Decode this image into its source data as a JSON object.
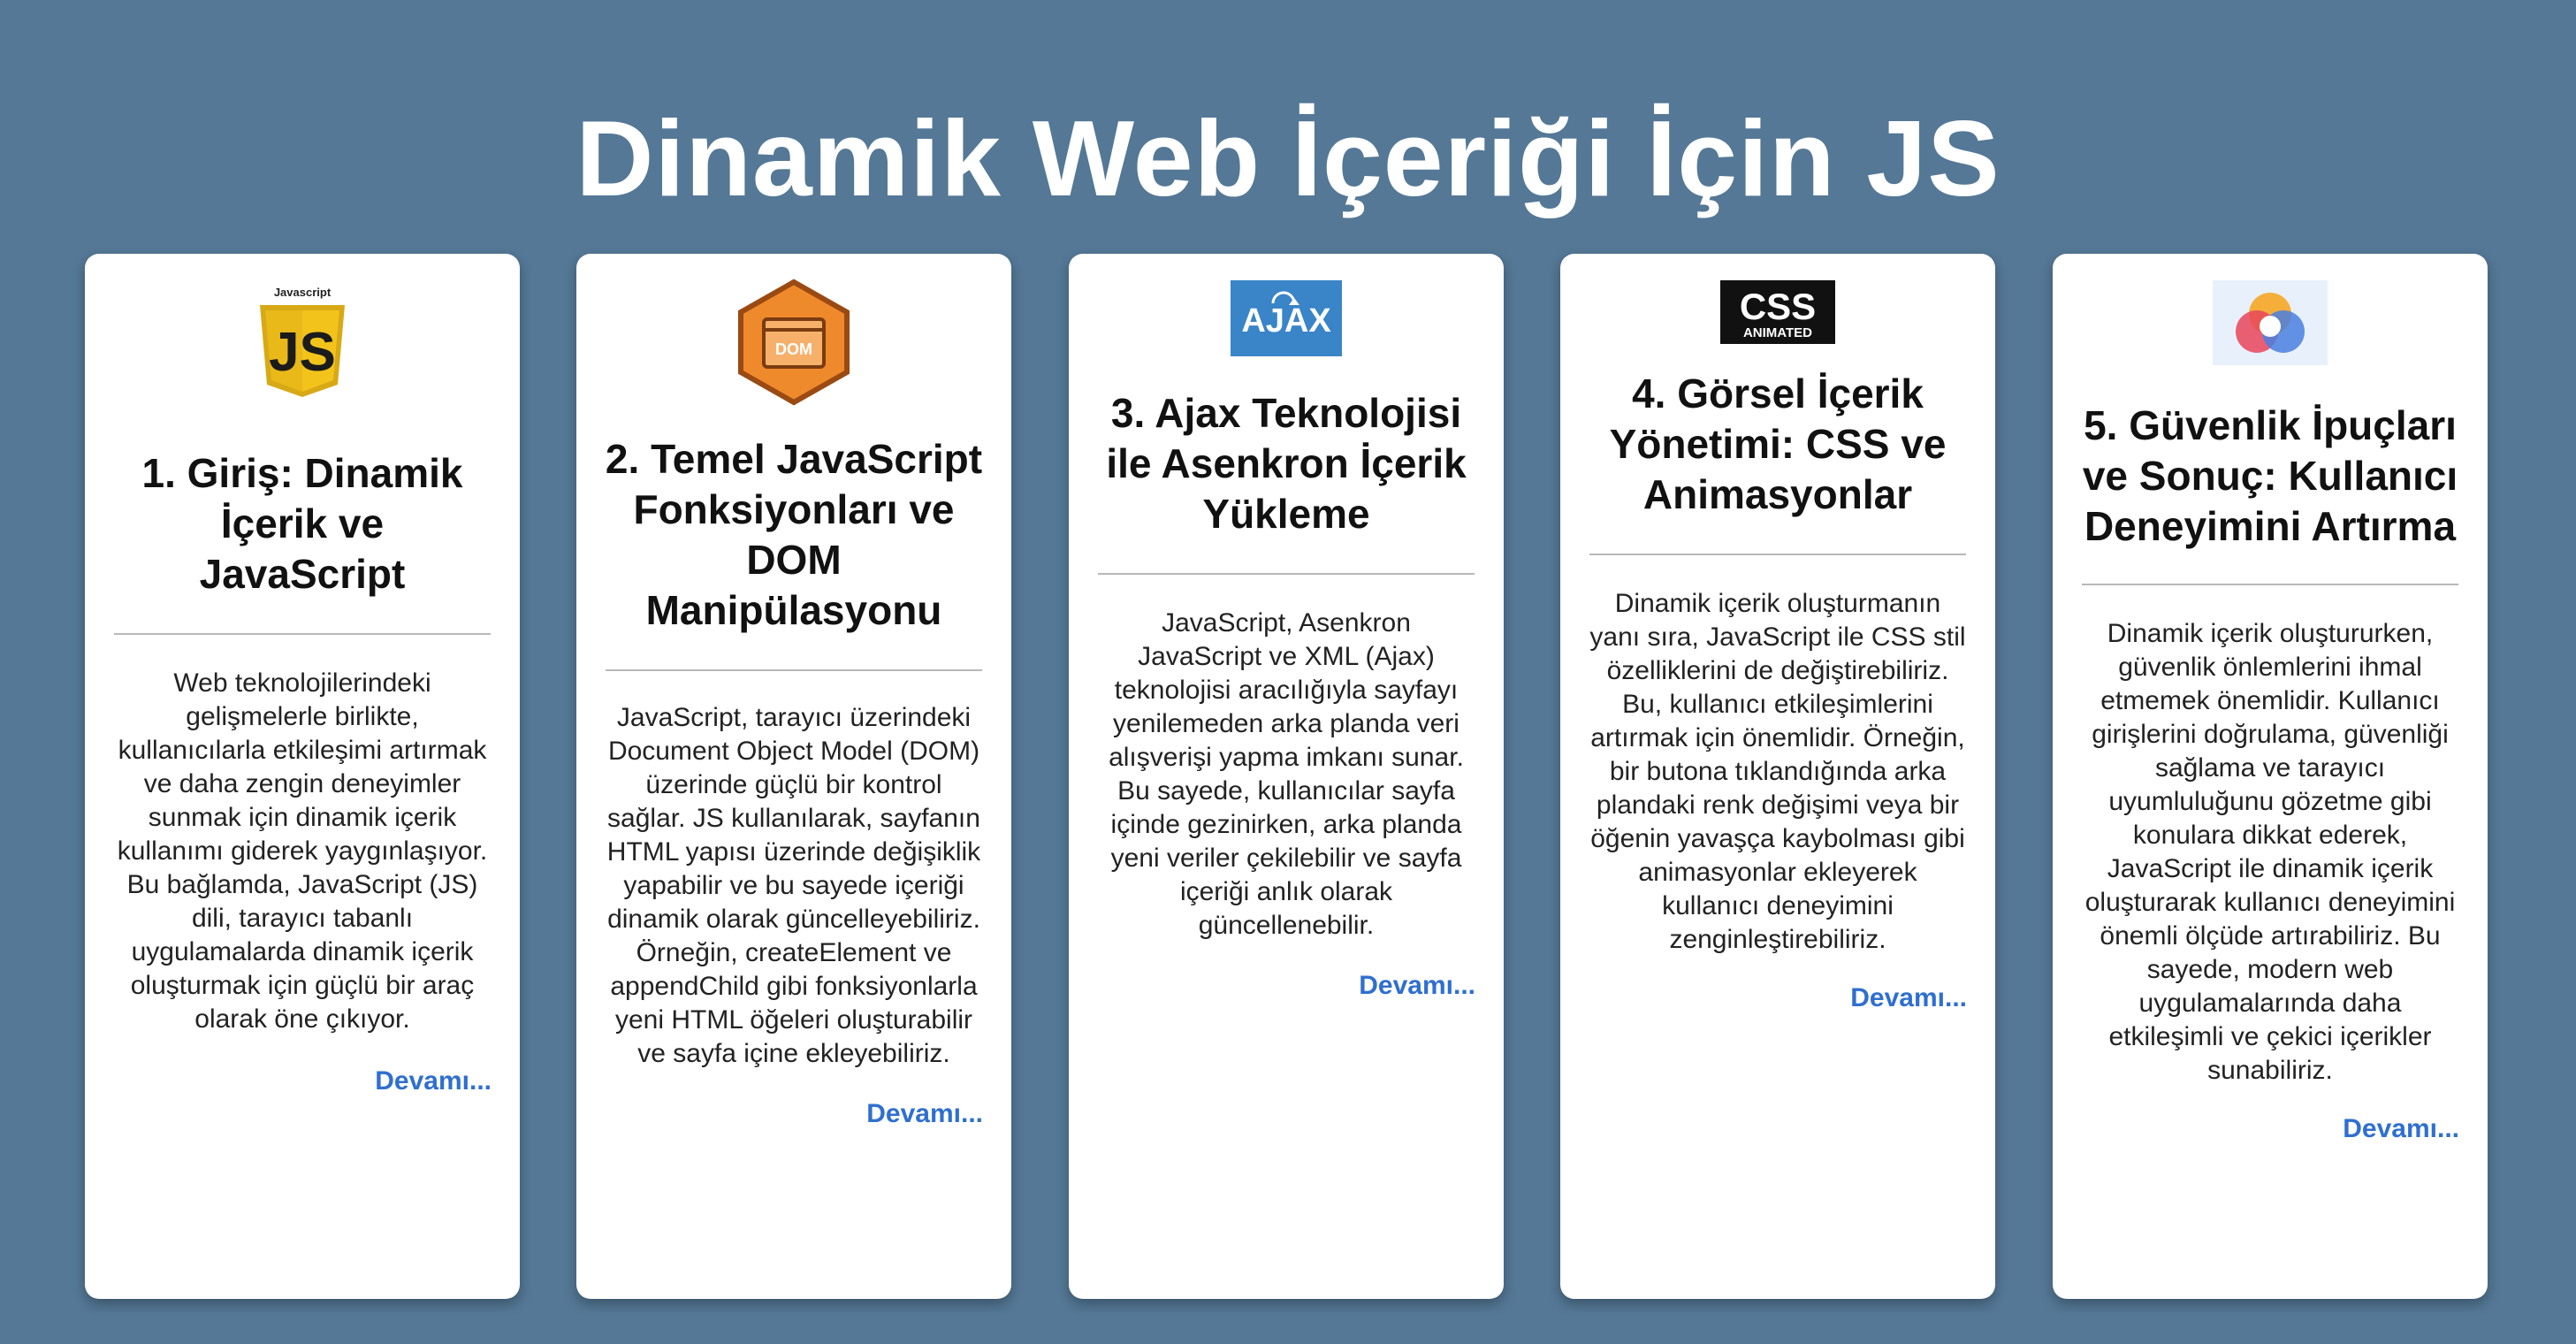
{
  "page": {
    "title": "Dinamik Web İçeriği İçin JS",
    "background": "#547896",
    "link_color": "#2f6fcf"
  },
  "cards": [
    {
      "logo": {
        "icon": "javascript-logo-icon",
        "label": "Javascript",
        "mark": "JS",
        "color": "#f2c31b"
      },
      "title": "1. Giriş: Dinamik İçerik ve JavaScript",
      "text": "Web teknolojilerindeki gelişmelerle birlikte, kullanıcılarla etkileşimi artırmak ve daha zengin deneyimler sunmak için dinamik içerik kullanımı giderek yaygınlaşıyor. Bu bağlamda, JavaScript (JS) dili, tarayıcı tabanlı uygulamalarda dinamik içerik oluşturmak için güçlü bir araç olarak öne çıkıyor.",
      "more": "Devamı..."
    },
    {
      "logo": {
        "icon": "dom-logo-icon",
        "mark": "DOM",
        "color": "#ef8a2c"
      },
      "title": "2. Temel JavaScript Fonksiyonları ve DOM Manipülasyonu",
      "text": "JavaScript, tarayıcı üzerindeki Document Object Model (DOM) üzerinde güçlü bir kontrol sağlar. JS kullanılarak, sayfanın HTML yapısı üzerinde değişiklik yapabilir ve bu sayede içeriği dinamik olarak güncelleyebiliriz. Örneğin, createElement ve appendChild gibi fonksiyonlarla yeni HTML öğeleri oluşturabilir ve sayfa içine ekleyebiliriz.",
      "more": "Devamı..."
    },
    {
      "logo": {
        "icon": "ajax-logo-icon",
        "mark": "AJAX",
        "color": "#3a84c8"
      },
      "title": "3. Ajax Teknolojisi ile Asenkron İçerik Yükleme",
      "text": "JavaScript, Asenkron JavaScript ve XML (Ajax) teknolojisi aracılığıyla sayfayı yenilemeden arka planda veri alışverişi yapma imkanı sunar. Bu sayede, kullanıcılar sayfa içinde gezinirken, arka planda yeni veriler çekilebilir ve sayfa içeriği anlık olarak güncellenebilir.",
      "more": "Devamı..."
    },
    {
      "logo": {
        "icon": "css-animated-logo-icon",
        "mark": "CSS",
        "sub": "ANIMATED",
        "color": "#111111"
      },
      "title": "4. Görsel İçerik Yönetimi: CSS ve Animasyonlar",
      "text": "Dinamik içerik oluşturmanın yanı sıra, JavaScript ile CSS stil özelliklerini de değiştirebiliriz. Bu, kullanıcı etkileşimlerini artırmak için önemlidir. Örneğin, bir butona tıklandığında arka plandaki renk değişimi veya bir öğenin yavaşça kaybolması gibi animasyonlar ekleyerek kullanıcı deneyimini zenginleştirebiliriz.",
      "more": "Devamı..."
    },
    {
      "logo": {
        "icon": "user-experience-logo-icon",
        "color": "#e8f1fb"
      },
      "title": "5. Güvenlik İpuçları ve Sonuç: Kullanıcı Deneyimini Artırma",
      "text": "Dinamik içerik oluştururken, güvenlik önlemlerini ihmal etmemek önemlidir. Kullanıcı girişlerini doğrulama, güvenliği sağlama ve tarayıcı uyumluluğunu gözetme gibi konulara dikkat ederek, JavaScript ile dinamik içerik oluşturarak kullanıcı deneyimini önemli ölçüde artırabiliriz. Bu sayede, modern web uygulamalarında daha etkileşimli ve çekici içerikler sunabiliriz.",
      "more": "Devamı..."
    }
  ]
}
